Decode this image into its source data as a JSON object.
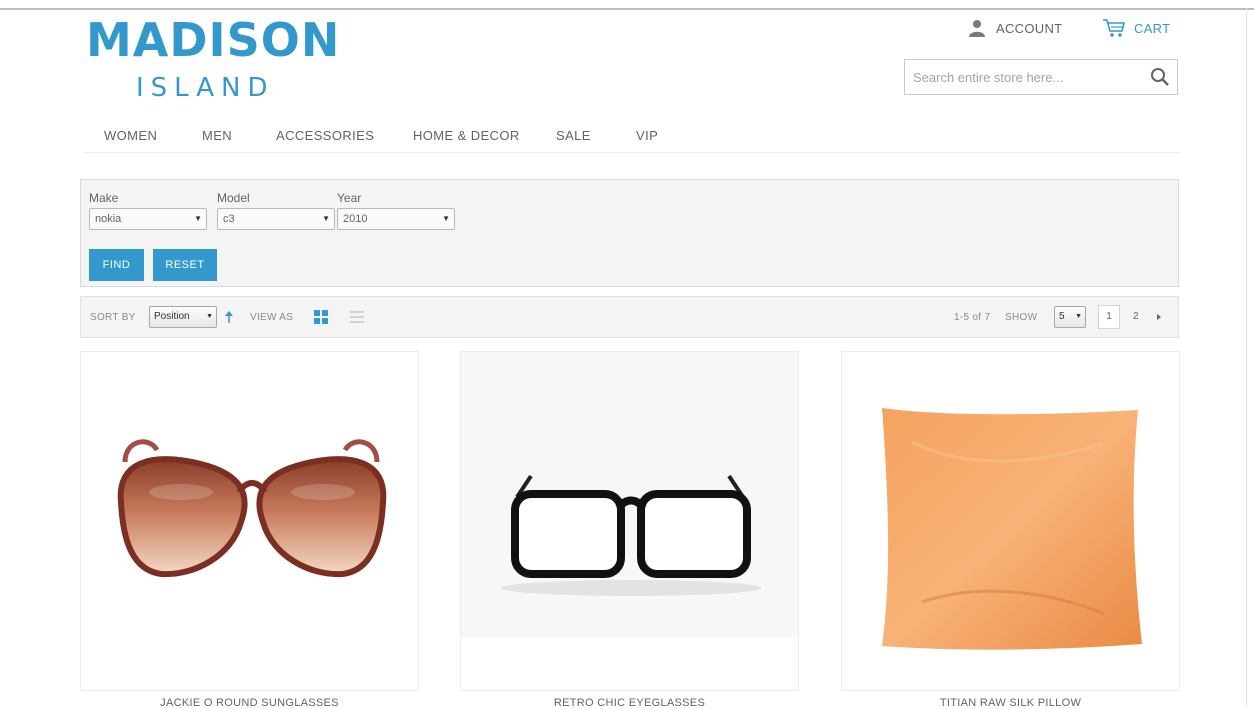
{
  "logo": {
    "main": "MADISON",
    "sub": "ISLAND"
  },
  "header": {
    "account_label": "ACCOUNT",
    "cart_label": "CART",
    "search_placeholder": "Search entire store here..."
  },
  "nav": {
    "items": [
      "WOMEN",
      "MEN",
      "ACCESSORIES",
      "HOME & DECOR",
      "SALE",
      "VIP"
    ]
  },
  "filter": {
    "make_label": "Make",
    "make_value": "nokia",
    "model_label": "Model",
    "model_value": "c3",
    "year_label": "Year",
    "year_value": "2010",
    "find_label": "FIND",
    "reset_label": "RESET"
  },
  "toolbar": {
    "sort_by_label": "SORT BY",
    "sort_value": "Position",
    "view_as_label": "VIEW AS",
    "count_text": "1-5 of 7",
    "show_label": "SHOW",
    "show_value": "5",
    "pages": [
      "1",
      "2"
    ]
  },
  "products": [
    {
      "name": "JACKIE O ROUND SUNGLASSES"
    },
    {
      "name": "RETRO CHIC EYEGLASSES"
    },
    {
      "name": "TITIAN RAW SILK PILLOW"
    }
  ],
  "colors": {
    "accent": "#3399cc",
    "text": "#636363",
    "panel": "#f4f4f4"
  },
  "icons": [
    "user-icon",
    "cart-icon",
    "search-icon",
    "sort-arrow-up-icon",
    "grid-view-icon",
    "list-view-icon",
    "next-page-icon",
    "select-arrow-icon"
  ]
}
